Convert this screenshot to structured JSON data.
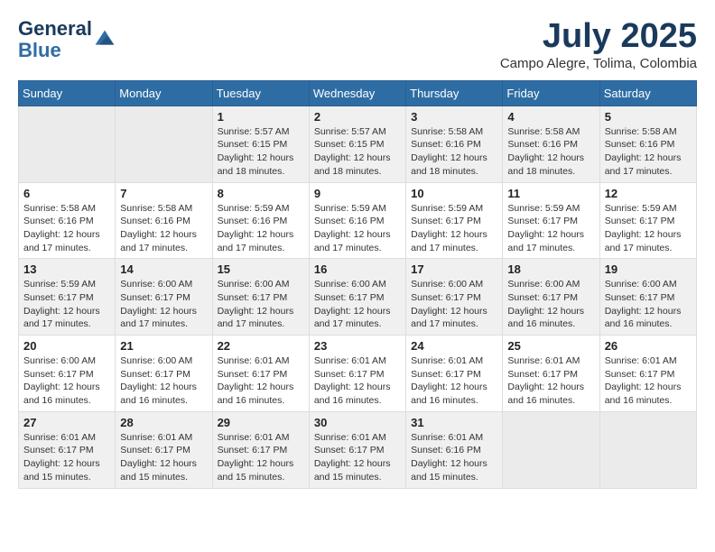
{
  "header": {
    "logo_line1": "General",
    "logo_line2": "Blue",
    "month": "July 2025",
    "location": "Campo Alegre, Tolima, Colombia"
  },
  "weekdays": [
    "Sunday",
    "Monday",
    "Tuesday",
    "Wednesday",
    "Thursday",
    "Friday",
    "Saturday"
  ],
  "weeks": [
    [
      {
        "day": "",
        "info": ""
      },
      {
        "day": "",
        "info": ""
      },
      {
        "day": "1",
        "info": "Sunrise: 5:57 AM\nSunset: 6:15 PM\nDaylight: 12 hours and 18 minutes."
      },
      {
        "day": "2",
        "info": "Sunrise: 5:57 AM\nSunset: 6:15 PM\nDaylight: 12 hours and 18 minutes."
      },
      {
        "day": "3",
        "info": "Sunrise: 5:58 AM\nSunset: 6:16 PM\nDaylight: 12 hours and 18 minutes."
      },
      {
        "day": "4",
        "info": "Sunrise: 5:58 AM\nSunset: 6:16 PM\nDaylight: 12 hours and 18 minutes."
      },
      {
        "day": "5",
        "info": "Sunrise: 5:58 AM\nSunset: 6:16 PM\nDaylight: 12 hours and 17 minutes."
      }
    ],
    [
      {
        "day": "6",
        "info": "Sunrise: 5:58 AM\nSunset: 6:16 PM\nDaylight: 12 hours and 17 minutes."
      },
      {
        "day": "7",
        "info": "Sunrise: 5:58 AM\nSunset: 6:16 PM\nDaylight: 12 hours and 17 minutes."
      },
      {
        "day": "8",
        "info": "Sunrise: 5:59 AM\nSunset: 6:16 PM\nDaylight: 12 hours and 17 minutes."
      },
      {
        "day": "9",
        "info": "Sunrise: 5:59 AM\nSunset: 6:16 PM\nDaylight: 12 hours and 17 minutes."
      },
      {
        "day": "10",
        "info": "Sunrise: 5:59 AM\nSunset: 6:17 PM\nDaylight: 12 hours and 17 minutes."
      },
      {
        "day": "11",
        "info": "Sunrise: 5:59 AM\nSunset: 6:17 PM\nDaylight: 12 hours and 17 minutes."
      },
      {
        "day": "12",
        "info": "Sunrise: 5:59 AM\nSunset: 6:17 PM\nDaylight: 12 hours and 17 minutes."
      }
    ],
    [
      {
        "day": "13",
        "info": "Sunrise: 5:59 AM\nSunset: 6:17 PM\nDaylight: 12 hours and 17 minutes."
      },
      {
        "day": "14",
        "info": "Sunrise: 6:00 AM\nSunset: 6:17 PM\nDaylight: 12 hours and 17 minutes."
      },
      {
        "day": "15",
        "info": "Sunrise: 6:00 AM\nSunset: 6:17 PM\nDaylight: 12 hours and 17 minutes."
      },
      {
        "day": "16",
        "info": "Sunrise: 6:00 AM\nSunset: 6:17 PM\nDaylight: 12 hours and 17 minutes."
      },
      {
        "day": "17",
        "info": "Sunrise: 6:00 AM\nSunset: 6:17 PM\nDaylight: 12 hours and 17 minutes."
      },
      {
        "day": "18",
        "info": "Sunrise: 6:00 AM\nSunset: 6:17 PM\nDaylight: 12 hours and 16 minutes."
      },
      {
        "day": "19",
        "info": "Sunrise: 6:00 AM\nSunset: 6:17 PM\nDaylight: 12 hours and 16 minutes."
      }
    ],
    [
      {
        "day": "20",
        "info": "Sunrise: 6:00 AM\nSunset: 6:17 PM\nDaylight: 12 hours and 16 minutes."
      },
      {
        "day": "21",
        "info": "Sunrise: 6:00 AM\nSunset: 6:17 PM\nDaylight: 12 hours and 16 minutes."
      },
      {
        "day": "22",
        "info": "Sunrise: 6:01 AM\nSunset: 6:17 PM\nDaylight: 12 hours and 16 minutes."
      },
      {
        "day": "23",
        "info": "Sunrise: 6:01 AM\nSunset: 6:17 PM\nDaylight: 12 hours and 16 minutes."
      },
      {
        "day": "24",
        "info": "Sunrise: 6:01 AM\nSunset: 6:17 PM\nDaylight: 12 hours and 16 minutes."
      },
      {
        "day": "25",
        "info": "Sunrise: 6:01 AM\nSunset: 6:17 PM\nDaylight: 12 hours and 16 minutes."
      },
      {
        "day": "26",
        "info": "Sunrise: 6:01 AM\nSunset: 6:17 PM\nDaylight: 12 hours and 16 minutes."
      }
    ],
    [
      {
        "day": "27",
        "info": "Sunrise: 6:01 AM\nSunset: 6:17 PM\nDaylight: 12 hours and 15 minutes."
      },
      {
        "day": "28",
        "info": "Sunrise: 6:01 AM\nSunset: 6:17 PM\nDaylight: 12 hours and 15 minutes."
      },
      {
        "day": "29",
        "info": "Sunrise: 6:01 AM\nSunset: 6:17 PM\nDaylight: 12 hours and 15 minutes."
      },
      {
        "day": "30",
        "info": "Sunrise: 6:01 AM\nSunset: 6:17 PM\nDaylight: 12 hours and 15 minutes."
      },
      {
        "day": "31",
        "info": "Sunrise: 6:01 AM\nSunset: 6:16 PM\nDaylight: 12 hours and 15 minutes."
      },
      {
        "day": "",
        "info": ""
      },
      {
        "day": "",
        "info": ""
      }
    ]
  ]
}
